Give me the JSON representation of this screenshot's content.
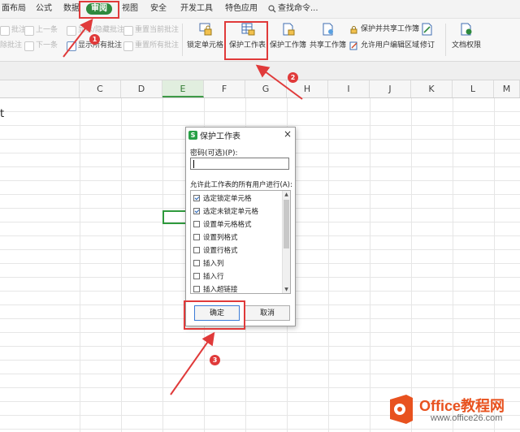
{
  "menubar": {
    "tabs": [
      "面布局",
      "公式",
      "数据",
      "审阅",
      "视图",
      "安全",
      "开发工具",
      "特色应用"
    ],
    "active_tab": "审阅",
    "search_label": "查找命令..."
  },
  "ribbon": {
    "left_small": [
      {
        "label": "上一条",
        "enabled": false
      },
      {
        "label": "下一条",
        "enabled": false
      },
      {
        "label": "显示所有批注",
        "enabled": true
      },
      {
        "label": "显示/隐藏批注",
        "enabled": false
      },
      {
        "label": "重置当前批注",
        "enabled": false
      },
      {
        "label": "重置所有批注",
        "enabled": false
      },
      {
        "label": "批注",
        "enabled": false
      },
      {
        "label": "除批注",
        "enabled": false
      }
    ],
    "big_buttons": [
      "锁定单元格",
      "保护工作表",
      "保护工作簿",
      "共享工作簿",
      "修订",
      "文档权限"
    ],
    "protect_share_label": "保护并共享工作簿",
    "allow_edit_label": "允许用户编辑区域"
  },
  "sheet": {
    "columns": [
      "C",
      "D",
      "E",
      "F",
      "G",
      "H",
      "I",
      "J",
      "K",
      "L",
      "M"
    ],
    "selected_column": "E",
    "partial_cell_text": "t"
  },
  "dialog": {
    "title": "保护工作表",
    "close_symbol": "×",
    "app_icon_letter": "S",
    "password_label": "密码(可选)(P):",
    "password_value": "",
    "permissions_label": "允许此工作表的所有用户进行(A):",
    "permissions": [
      {
        "label": "选定锁定单元格",
        "checked": true
      },
      {
        "label": "选定未锁定单元格",
        "checked": true
      },
      {
        "label": "设置单元格格式",
        "checked": false
      },
      {
        "label": "设置列格式",
        "checked": false
      },
      {
        "label": "设置行格式",
        "checked": false
      },
      {
        "label": "插入列",
        "checked": false
      },
      {
        "label": "插入行",
        "checked": false
      },
      {
        "label": "插入超链接",
        "checked": false
      }
    ],
    "ok_label": "确定",
    "cancel_label": "取消"
  },
  "annotations": {
    "step_numbers": [
      "1",
      "2",
      "3"
    ],
    "highlight_color": "#e03a3a"
  },
  "watermark": {
    "brand": "Office教程网",
    "url": "www.office26.com"
  },
  "colors": {
    "active_tab": "#2f8a3e",
    "selection": "#2f9a3d",
    "brand_orange": "#e8521f"
  }
}
